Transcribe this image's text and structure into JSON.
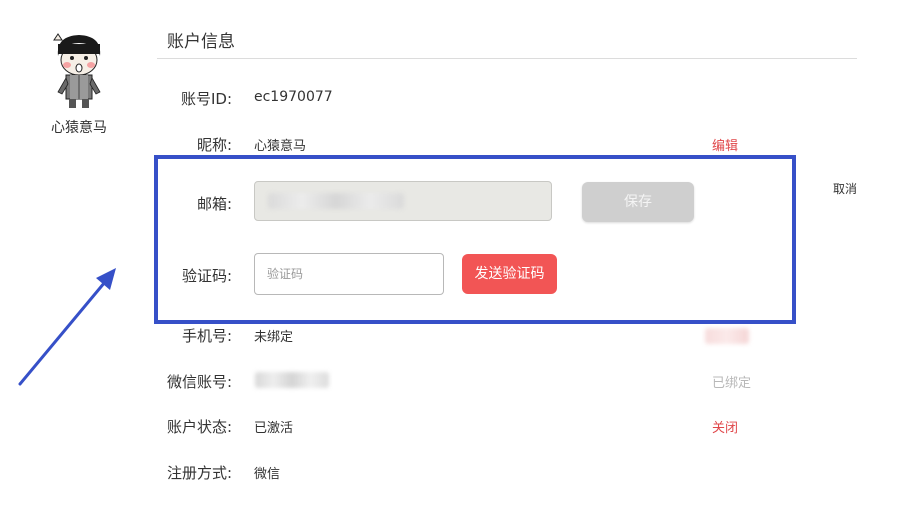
{
  "profile": {
    "username": "心猿意马"
  },
  "section": {
    "title": "账户信息"
  },
  "fields": {
    "account_id": {
      "label": "账号ID:",
      "value": "ec1970077"
    },
    "nickname": {
      "label": "昵称:",
      "value": "心猿意马",
      "action": "编辑"
    },
    "cancel": {
      "action": "取消"
    },
    "email": {
      "label": "邮箱:",
      "save_label": "保存"
    },
    "verify_code": {
      "label": "验证码:",
      "placeholder": "验证码",
      "send_label": "发送验证码"
    },
    "phone": {
      "label": "手机号:",
      "value": "未绑定"
    },
    "wechat_account": {
      "label": "微信账号:",
      "action": "已绑定"
    },
    "account_status": {
      "label": "账户状态:",
      "value": "已激活",
      "action": "关闭"
    },
    "register_method": {
      "label": "注册方式:",
      "value": "微信"
    }
  },
  "colors": {
    "accent_red": "#f25555",
    "action_red": "#e0474a",
    "highlight_blue": "#3650c8",
    "disabled_text": "#b8b8b8"
  }
}
